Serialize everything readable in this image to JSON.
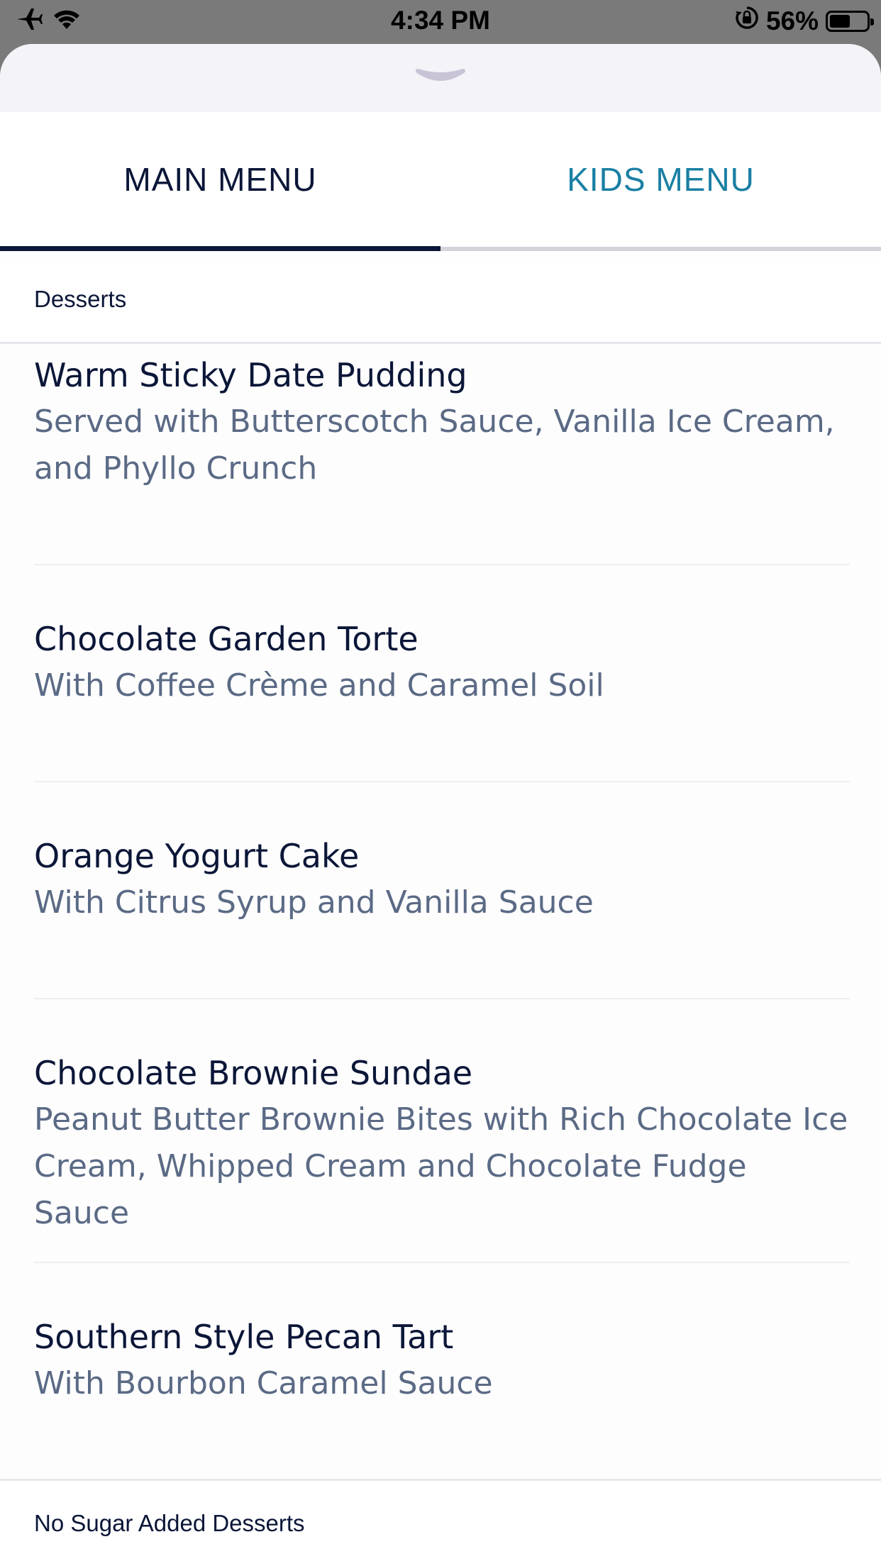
{
  "status_bar": {
    "time": "4:34 PM",
    "battery_text": "56%",
    "battery_level": 0.56,
    "icons": [
      "airplane-icon",
      "wifi-icon",
      "orientation-lock-icon",
      "battery-icon"
    ]
  },
  "sheet": {
    "grabber_icon": "chevron-down-icon"
  },
  "tabs": [
    {
      "label": "MAIN MENU",
      "active": true
    },
    {
      "label": "KIDS MENU",
      "active": false
    }
  ],
  "colors": {
    "navy": "#0b1638",
    "accent": "#1a7fa3",
    "description": "#5b6a85"
  },
  "sections": [
    {
      "title": "Desserts"
    },
    {
      "title": "No Sugar Added Desserts"
    }
  ],
  "items": [
    {
      "name": "Warm Sticky Date Pudding",
      "desc_lines": [
        "Served with Butterscotch Sauce, Vanilla Ice Cream,",
        "and Phyllo Crunch"
      ]
    },
    {
      "name": "Chocolate Garden Torte",
      "desc_lines": [
        "With Coffee Crème and Caramel Soil"
      ]
    },
    {
      "name": "Orange Yogurt Cake",
      "desc_lines": [
        "With Citrus Syrup and Vanilla Sauce"
      ]
    },
    {
      "name": "Chocolate Brownie Sundae",
      "desc_lines": [
        "Peanut Butter Brownie Bites with Rich Chocolate Ice",
        "Cream, Whipped Cream and Chocolate Fudge Sauce"
      ]
    },
    {
      "name": "Southern Style Pecan Tart",
      "desc_lines": [
        "With Bourbon Caramel Sauce"
      ]
    }
  ]
}
